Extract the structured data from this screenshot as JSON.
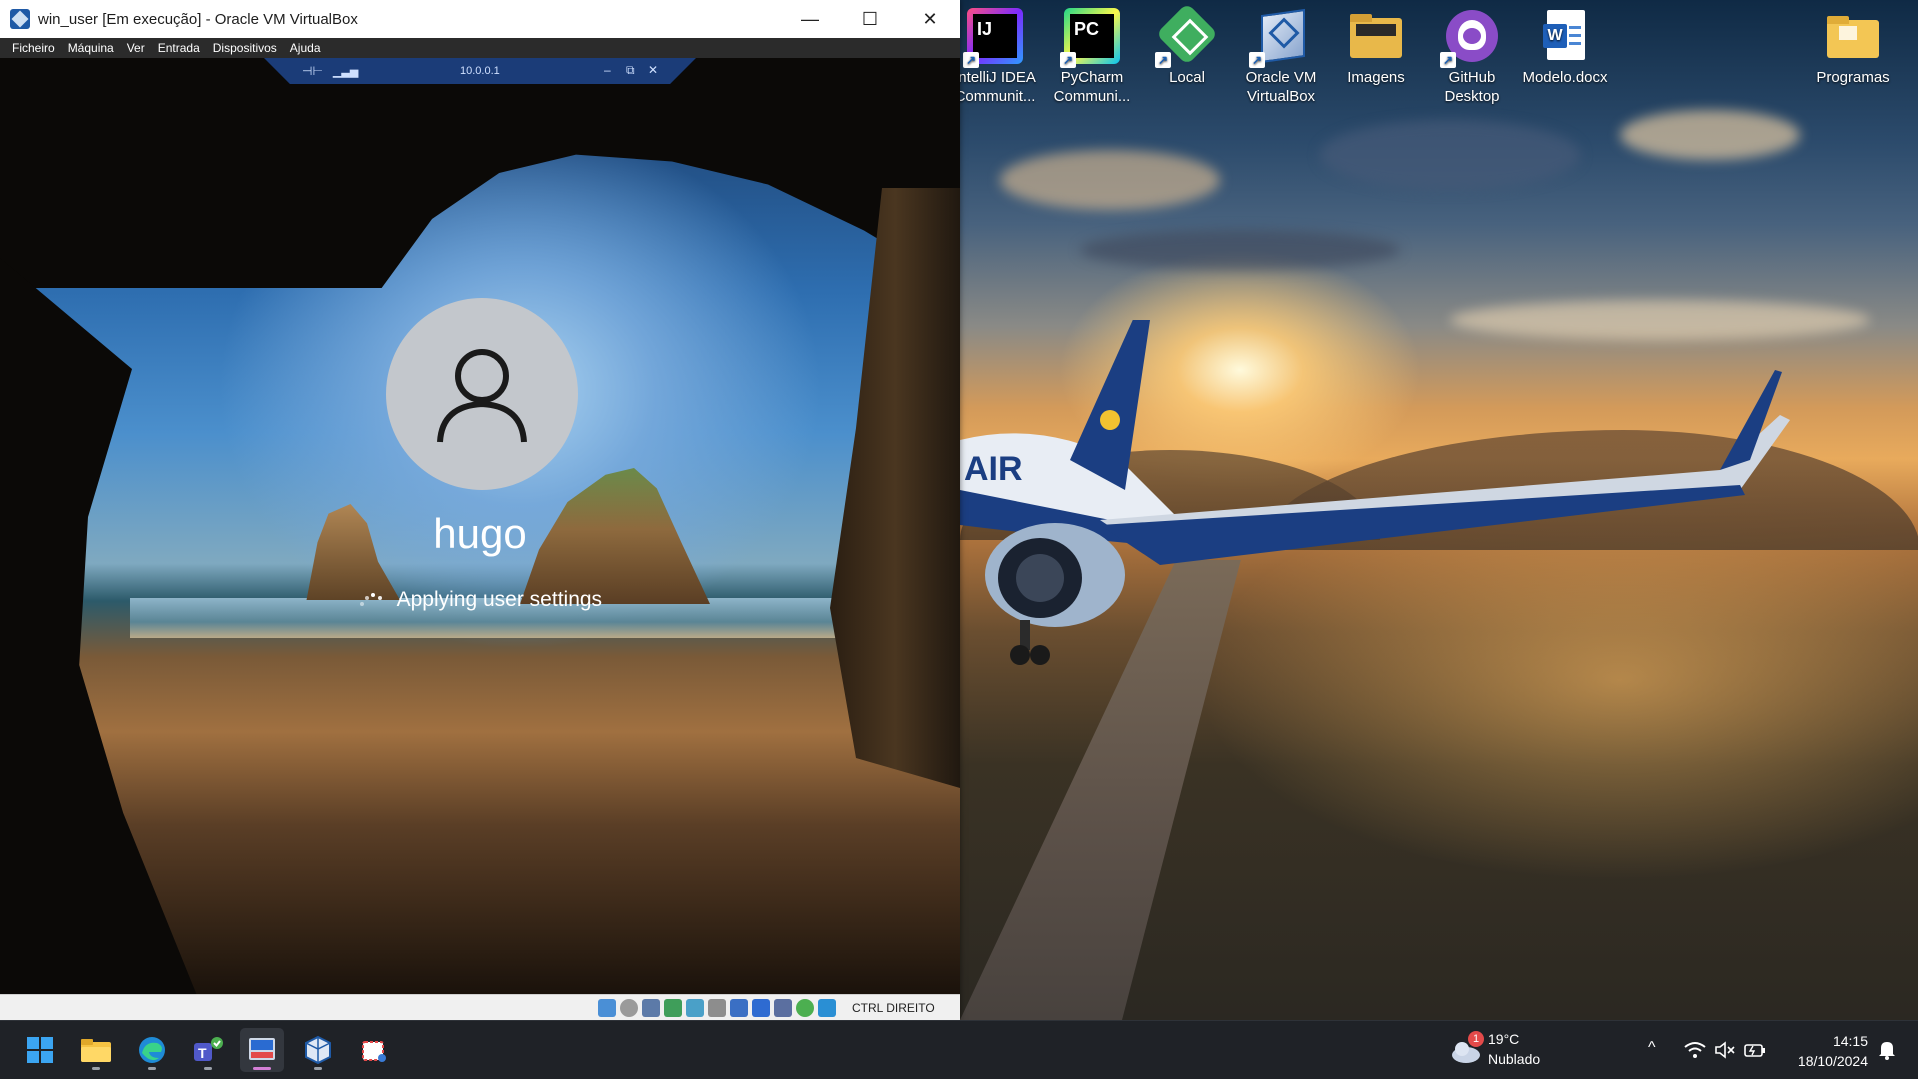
{
  "vbox": {
    "window_title": "win_user [Em execução] - Oracle VM VirtualBox",
    "controls": {
      "minimize": "—",
      "maximize": "☐",
      "close": "✕"
    },
    "menu": [
      "Ficheiro",
      "Máquina",
      "Ver",
      "Entrada",
      "Dispositivos",
      "Ajuda"
    ],
    "mini_toolbar": {
      "address": "10.0.0.1"
    },
    "host_key": "CTRL DIREITO"
  },
  "guest": {
    "username": "hugo",
    "status": "Applying user settings"
  },
  "desktop": {
    "icons": [
      {
        "label": "IntelliJ IDEA Communit...",
        "icon": "intellij-icon",
        "glyph": "IJ",
        "bg": "#1c1c3c",
        "fg": "#ffffff"
      },
      {
        "label": "PyCharm Communi...",
        "icon": "pycharm-icon",
        "glyph": "PC",
        "bg": "#000000",
        "fg": "#ffffff"
      },
      {
        "label": "Local",
        "icon": "local-icon",
        "glyph": "◇",
        "bg": "#43a047",
        "fg": "#ffffff"
      },
      {
        "label": "Oracle VM VirtualBox",
        "icon": "virtualbox-icon",
        "glyph": "▣",
        "bg": "#c9d6ea",
        "fg": "#1f5aa6"
      },
      {
        "label": "Imagens",
        "icon": "folder-images-icon",
        "glyph": "",
        "bg": "#e8b84a",
        "fg": "#ffffff"
      },
      {
        "label": "GitHub Desktop",
        "icon": "github-desktop-icon",
        "glyph": "◉",
        "bg": "#7b3fb5",
        "fg": "#ffffff"
      },
      {
        "label": "Modelo.docx",
        "icon": "word-doc-icon",
        "glyph": "W",
        "bg": "#ffffff",
        "fg": "#1e5fb8"
      },
      {
        "label": "Programas",
        "icon": "folder-icon",
        "glyph": "",
        "bg": "#f0c050",
        "fg": "#ffffff"
      }
    ]
  },
  "taskbar": {
    "weather": {
      "temp": "19°C",
      "condition": "Nublado",
      "badge": "1"
    },
    "time": "14:15",
    "date": "18/10/2024",
    "tray_expand": "^"
  },
  "colors": {
    "titlebar_bg": "#ffffff",
    "menubar_bg": "#2b2b2b",
    "taskbar_bg": "#1f2227",
    "active_indicator": "#d47fd6"
  }
}
